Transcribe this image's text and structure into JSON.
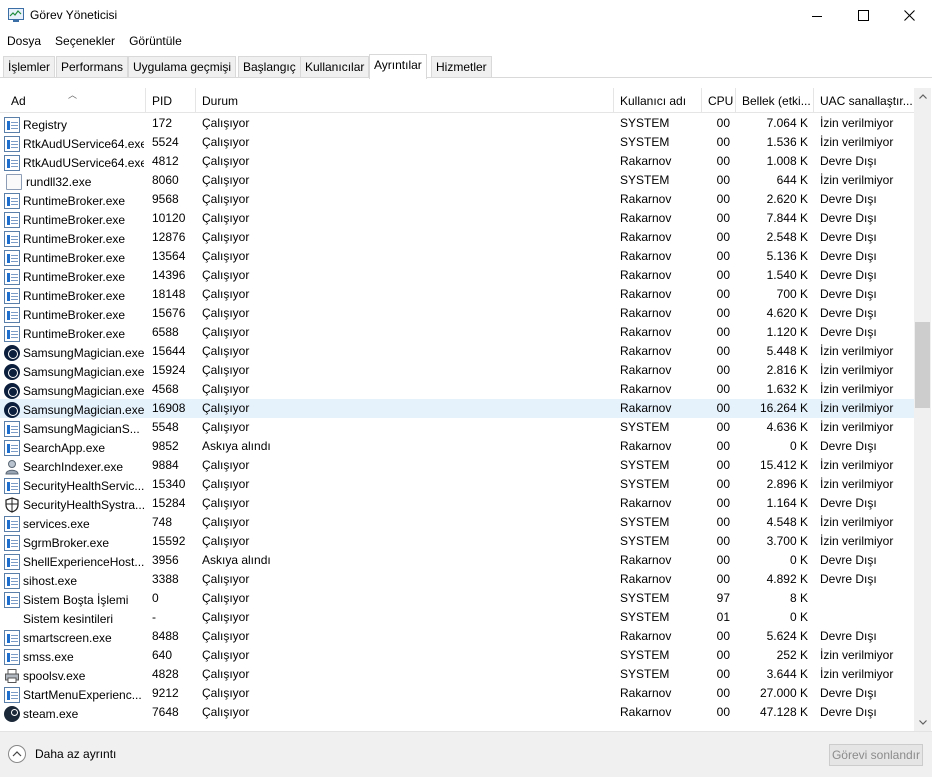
{
  "window": {
    "title": "Görev Yöneticisi"
  },
  "menu": [
    "Dosya",
    "Seçenekler",
    "Görüntüle"
  ],
  "tabs": [
    "İşlemler",
    "Performans",
    "Uygulama geçmişi",
    "Başlangıç",
    "Kullanıcılar",
    "Ayrıntılar",
    "Hizmetler"
  ],
  "active_tab": "Ayrıntılar",
  "columns": {
    "name": "Ad",
    "pid": "PID",
    "status": "Durum",
    "user": "Kullanıcı adı",
    "cpu": "CPU",
    "memory": "Bellek (etki...",
    "uac": "UAC sanallaştır..."
  },
  "rows": [
    {
      "icon": "app",
      "name": "Registry",
      "pid": "172",
      "status": "Çalışıyor",
      "user": "SYSTEM",
      "cpu": "00",
      "memory": "7.064 K",
      "uac": "İzin verilmiyor"
    },
    {
      "icon": "app",
      "name": "RtkAudUService64.exe",
      "pid": "5524",
      "status": "Çalışıyor",
      "user": "SYSTEM",
      "cpu": "00",
      "memory": "1.536 K",
      "uac": "İzin verilmiyor"
    },
    {
      "icon": "app",
      "name": "RtkAudUService64.exe",
      "pid": "4812",
      "status": "Çalışıyor",
      "user": "Rakarnov",
      "cpu": "00",
      "memory": "1.008 K",
      "uac": "Devre Dışı"
    },
    {
      "icon": "doc",
      "name": "rundll32.exe",
      "pid": "8060",
      "status": "Çalışıyor",
      "user": "SYSTEM",
      "cpu": "00",
      "memory": "644 K",
      "uac": "İzin verilmiyor"
    },
    {
      "icon": "app",
      "name": "RuntimeBroker.exe",
      "pid": "9568",
      "status": "Çalışıyor",
      "user": "Rakarnov",
      "cpu": "00",
      "memory": "2.620 K",
      "uac": "Devre Dışı"
    },
    {
      "icon": "app",
      "name": "RuntimeBroker.exe",
      "pid": "10120",
      "status": "Çalışıyor",
      "user": "Rakarnov",
      "cpu": "00",
      "memory": "7.844 K",
      "uac": "Devre Dışı"
    },
    {
      "icon": "app",
      "name": "RuntimeBroker.exe",
      "pid": "12876",
      "status": "Çalışıyor",
      "user": "Rakarnov",
      "cpu": "00",
      "memory": "2.548 K",
      "uac": "Devre Dışı"
    },
    {
      "icon": "app",
      "name": "RuntimeBroker.exe",
      "pid": "13564",
      "status": "Çalışıyor",
      "user": "Rakarnov",
      "cpu": "00",
      "memory": "5.136 K",
      "uac": "Devre Dışı"
    },
    {
      "icon": "app",
      "name": "RuntimeBroker.exe",
      "pid": "14396",
      "status": "Çalışıyor",
      "user": "Rakarnov",
      "cpu": "00",
      "memory": "1.540 K",
      "uac": "Devre Dışı"
    },
    {
      "icon": "app",
      "name": "RuntimeBroker.exe",
      "pid": "18148",
      "status": "Çalışıyor",
      "user": "Rakarnov",
      "cpu": "00",
      "memory": "700 K",
      "uac": "Devre Dışı"
    },
    {
      "icon": "app",
      "name": "RuntimeBroker.exe",
      "pid": "15676",
      "status": "Çalışıyor",
      "user": "Rakarnov",
      "cpu": "00",
      "memory": "4.620 K",
      "uac": "Devre Dışı"
    },
    {
      "icon": "app",
      "name": "RuntimeBroker.exe",
      "pid": "6588",
      "status": "Çalışıyor",
      "user": "Rakarnov",
      "cpu": "00",
      "memory": "1.120 K",
      "uac": "Devre Dışı"
    },
    {
      "icon": "samsung",
      "name": "SamsungMagician.exe",
      "pid": "15644",
      "status": "Çalışıyor",
      "user": "Rakarnov",
      "cpu": "00",
      "memory": "5.448 K",
      "uac": "İzin verilmiyor"
    },
    {
      "icon": "samsung",
      "name": "SamsungMagician.exe",
      "pid": "15924",
      "status": "Çalışıyor",
      "user": "Rakarnov",
      "cpu": "00",
      "memory": "2.816 K",
      "uac": "İzin verilmiyor"
    },
    {
      "icon": "samsung",
      "name": "SamsungMagician.exe",
      "pid": "4568",
      "status": "Çalışıyor",
      "user": "Rakarnov",
      "cpu": "00",
      "memory": "1.632 K",
      "uac": "İzin verilmiyor"
    },
    {
      "icon": "samsung",
      "name": "SamsungMagician.exe",
      "pid": "16908",
      "status": "Çalışıyor",
      "user": "Rakarnov",
      "cpu": "00",
      "memory": "16.264 K",
      "uac": "İzin verilmiyor",
      "selected": true
    },
    {
      "icon": "app",
      "name": "SamsungMagicianS...",
      "pid": "5548",
      "status": "Çalışıyor",
      "user": "SYSTEM",
      "cpu": "00",
      "memory": "4.636 K",
      "uac": "İzin verilmiyor"
    },
    {
      "icon": "app",
      "name": "SearchApp.exe",
      "pid": "9852",
      "status": "Askıya alındı",
      "user": "Rakarnov",
      "cpu": "00",
      "memory": "0 K",
      "uac": "Devre Dışı"
    },
    {
      "icon": "indexer",
      "name": "SearchIndexer.exe",
      "pid": "9884",
      "status": "Çalışıyor",
      "user": "SYSTEM",
      "cpu": "00",
      "memory": "15.412 K",
      "uac": "İzin verilmiyor"
    },
    {
      "icon": "app",
      "name": "SecurityHealthServic...",
      "pid": "15340",
      "status": "Çalışıyor",
      "user": "SYSTEM",
      "cpu": "00",
      "memory": "2.896 K",
      "uac": "İzin verilmiyor"
    },
    {
      "icon": "shield",
      "name": "SecurityHealthSystra...",
      "pid": "15284",
      "status": "Çalışıyor",
      "user": "Rakarnov",
      "cpu": "00",
      "memory": "1.164 K",
      "uac": "Devre Dışı"
    },
    {
      "icon": "app",
      "name": "services.exe",
      "pid": "748",
      "status": "Çalışıyor",
      "user": "SYSTEM",
      "cpu": "00",
      "memory": "4.548 K",
      "uac": "İzin verilmiyor"
    },
    {
      "icon": "app",
      "name": "SgrmBroker.exe",
      "pid": "15592",
      "status": "Çalışıyor",
      "user": "SYSTEM",
      "cpu": "00",
      "memory": "3.700 K",
      "uac": "İzin verilmiyor"
    },
    {
      "icon": "app",
      "name": "ShellExperienceHost....",
      "pid": "3956",
      "status": "Askıya alındı",
      "user": "Rakarnov",
      "cpu": "00",
      "memory": "0 K",
      "uac": "Devre Dışı"
    },
    {
      "icon": "app",
      "name": "sihost.exe",
      "pid": "3388",
      "status": "Çalışıyor",
      "user": "Rakarnov",
      "cpu": "00",
      "memory": "4.892 K",
      "uac": "Devre Dışı"
    },
    {
      "icon": "app",
      "name": "Sistem Boşta İşlemi",
      "pid": "0",
      "status": "Çalışıyor",
      "user": "SYSTEM",
      "cpu": "97",
      "memory": "8 K",
      "uac": ""
    },
    {
      "icon": "none",
      "name": "Sistem kesintileri",
      "pid": "-",
      "status": "Çalışıyor",
      "user": "SYSTEM",
      "cpu": "01",
      "memory": "0 K",
      "uac": ""
    },
    {
      "icon": "app",
      "name": "smartscreen.exe",
      "pid": "8488",
      "status": "Çalışıyor",
      "user": "Rakarnov",
      "cpu": "00",
      "memory": "5.624 K",
      "uac": "Devre Dışı"
    },
    {
      "icon": "app",
      "name": "smss.exe",
      "pid": "640",
      "status": "Çalışıyor",
      "user": "SYSTEM",
      "cpu": "00",
      "memory": "252 K",
      "uac": "İzin verilmiyor"
    },
    {
      "icon": "printer",
      "name": "spoolsv.exe",
      "pid": "4828",
      "status": "Çalışıyor",
      "user": "SYSTEM",
      "cpu": "00",
      "memory": "3.644 K",
      "uac": "İzin verilmiyor"
    },
    {
      "icon": "app",
      "name": "StartMenuExperienc...",
      "pid": "9212",
      "status": "Çalışıyor",
      "user": "Rakarnov",
      "cpu": "00",
      "memory": "27.000 K",
      "uac": "Devre Dışı"
    },
    {
      "icon": "steam",
      "name": "steam.exe",
      "pid": "7648",
      "status": "Çalışıyor",
      "user": "Rakarnov",
      "cpu": "00",
      "memory": "47.128 K",
      "uac": "Devre Dışı"
    }
  ],
  "footer": {
    "less_detail": "Daha az ayrıntı",
    "end_task": "Görevi sonlandır"
  }
}
